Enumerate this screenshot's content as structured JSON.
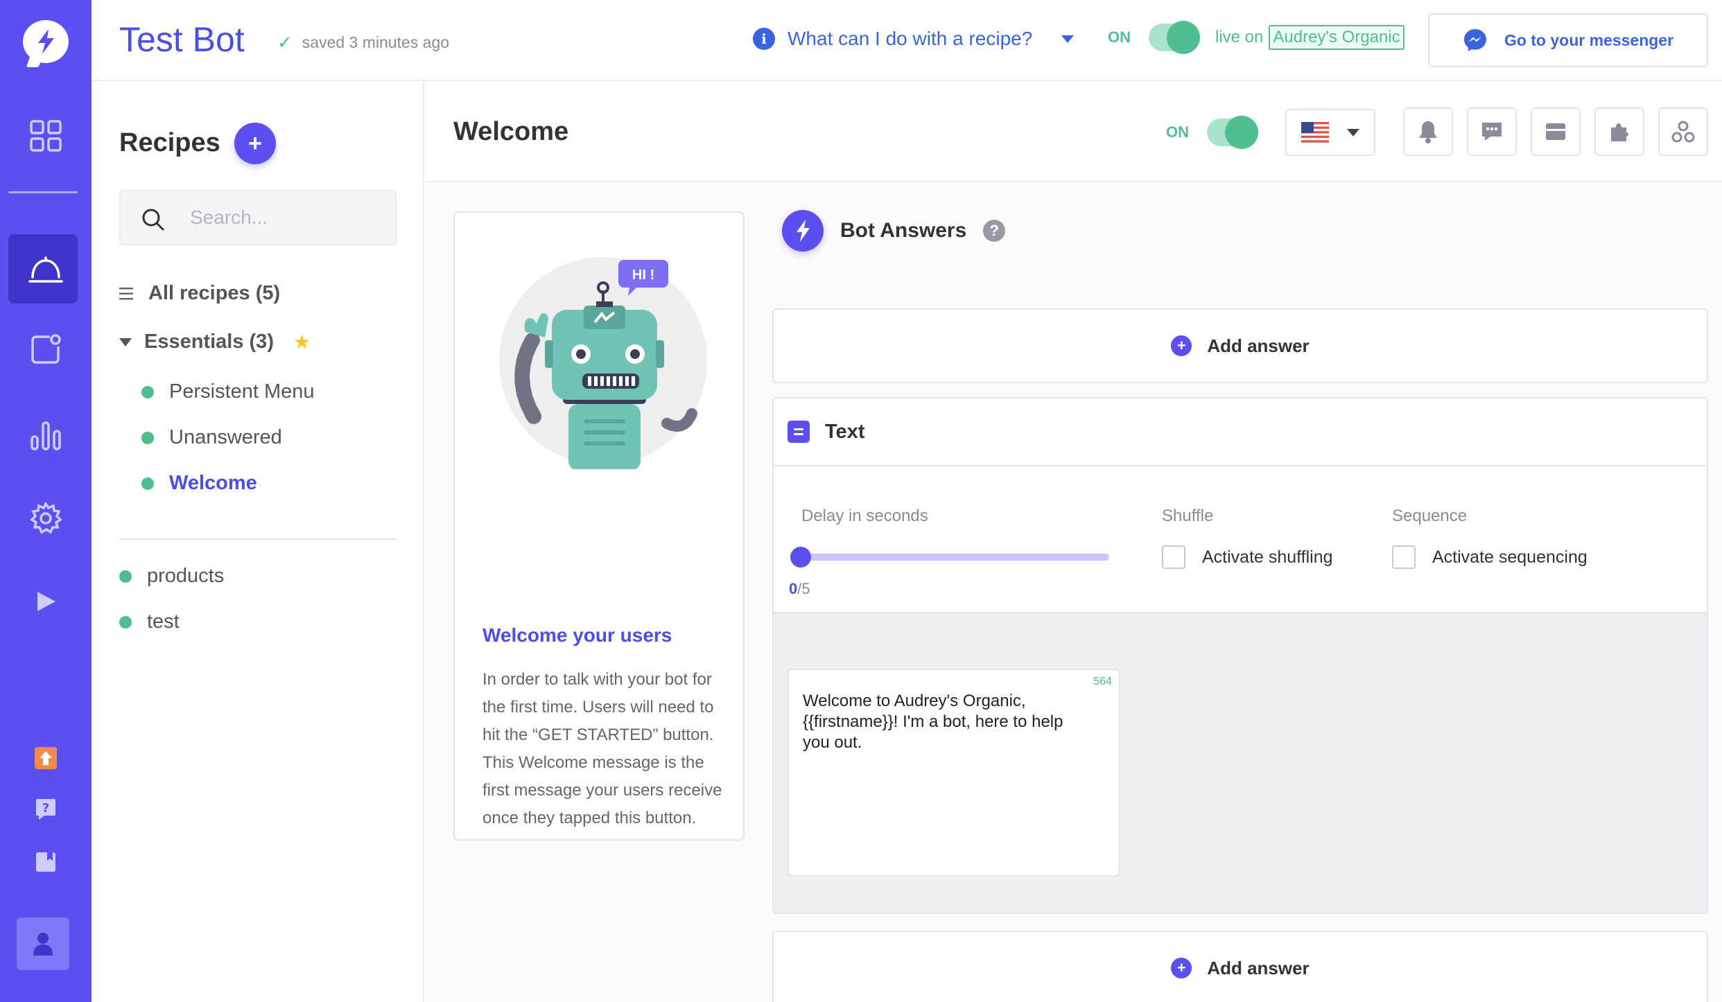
{
  "header": {
    "app_title": "Test Bot",
    "saved_status": "saved 3 minutes ago",
    "help_link": "What can I do with a recipe?",
    "on_label": "ON",
    "live_on_label": "live on",
    "live_page": "Audrey's Organic",
    "messenger_button": "Go to your messenger"
  },
  "sidebar": {
    "title": "Recipes",
    "add_label": "+",
    "search_placeholder": "Search...",
    "all_recipes": "All recipes (5)",
    "essentials": "Essentials (3)",
    "essentials_items": [
      {
        "label": "Persistent Menu"
      },
      {
        "label": "Unanswered"
      },
      {
        "label": "Welcome"
      }
    ],
    "other_items": [
      {
        "label": "products"
      },
      {
        "label": "test"
      }
    ]
  },
  "main": {
    "title": "Welcome",
    "on_label": "ON",
    "toolbar_icons": [
      "bell-icon",
      "comment-icon",
      "inbox-icon",
      "puzzle-icon",
      "share-icon"
    ]
  },
  "info_card": {
    "bubble_text": "HI !",
    "title": "Welcome your users",
    "text": "In order to talk with your bot for the first time. Users will need to hit the “GET STARTED” button. This Welcome message is the first message your users receive once they tapped this button."
  },
  "bot_answers": {
    "title": "Bot Answers",
    "help": "?",
    "add_answer": "Add answer",
    "text_block": {
      "title": "Text",
      "delay_label": "Delay in seconds",
      "delay_value": "0",
      "delay_max": "/5",
      "shuffle_label": "Shuffle",
      "shuffle_checkbox": "Activate shuffling",
      "sequence_label": "Sequence",
      "sequence_checkbox": "Activate sequencing",
      "message_count": "564",
      "message": "Welcome to Audrey's Organic, {{firstname}}! I'm a bot, here to help you out."
    }
  },
  "colors": {
    "brand": "#5b4ff0",
    "title_blue": "#4a4ee8",
    "link_blue": "#3a63e0",
    "green": "#4fbf8f"
  }
}
